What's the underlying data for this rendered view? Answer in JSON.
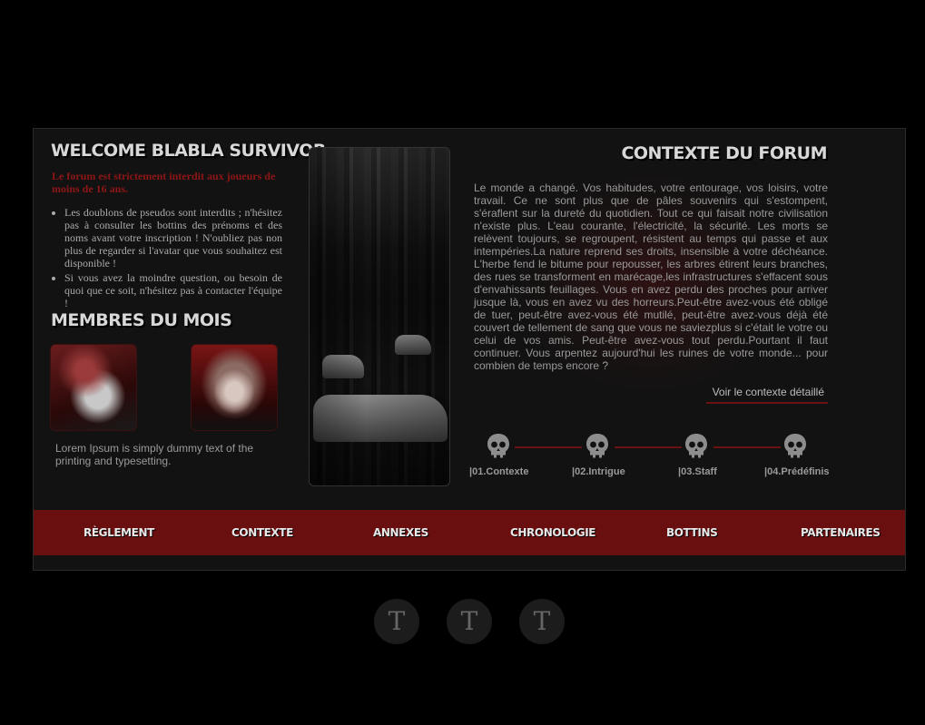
{
  "left": {
    "welcome_title": "WELCOME BLABLA SURVIVOR",
    "warning": "Le forum est strictement interdit aux joueurs de moins de 16 ans.",
    "rules": [
      "Les doublons de pseudos sont interdits ; n'hésitez pas à consulter les bottins des prénoms et des noms avant votre inscription ! N'oubliez pas non plus de regarder si l'avatar que vous souhaitez est disponible !",
      "Si vous avez la moindre question, ou besoin de quoi que ce soit, n'hésitez pas à contacter l'équipe !"
    ],
    "members_title": "MEMBRES DU MOIS",
    "lorem": "Lorem Ipsum is simply dummy text of the printing and typesetting."
  },
  "context": {
    "title": "CONTEXTE DU FORUM",
    "text": "Le monde a changé. Vos habitudes, votre entourage, vos loisirs, votre travail. Ce ne sont plus que de pâles souvenirs qui s'estompent, s'éraflent sur la dureté du quotidien. Tout ce qui faisait notre civilisation n'existe plus. L'eau courante, l'électricité, la sécurité. Les morts se relèvent toujours, se regroupent, résistent au temps qui passe et aux intempéries.La nature reprend ses droits, insensible à votre déchéance. L'herbe fend le bitume pour repousser, les arbres étirent leurs branches, des rues se transforment en marécage,les infrastructures s'effacent sous d'envahissants feuillages. Vous en avez perdu des proches pour arriver jusque là, vous en avez vu des horreurs.Peut-être avez-vous été obligé de tuer, peut-être avez-vous été mutilé, peut-être avez-vous déjà été couvert de tellement de sang que vous ne saviezplus si c'était le votre ou celui de vos amis. Peut-être avez-vous tout perdu.Pourtant il faut continuer. Vous arpentez aujourd'hui les ruines de votre monde... pour combien de temps encore ?",
    "link": "Voir le contexte détaillé"
  },
  "timeline": [
    {
      "label": "|01.Contexte",
      "icon": "skull-icon"
    },
    {
      "label": "|02.Intrigue",
      "icon": "skull-icon"
    },
    {
      "label": "|03.Staff",
      "icon": "skull-icon"
    },
    {
      "label": "|04.Prédéfinis",
      "icon": "skull-icon"
    }
  ],
  "nav": [
    "RÈGLEMENT",
    "CONTEXTE",
    "ANNEXES",
    "CHRONOLOGIE",
    "BOTTINS",
    "PARTENAIRES"
  ],
  "social": [
    "T",
    "T",
    "T"
  ],
  "colors": {
    "accent": "#6a0f0f",
    "background": "#000000",
    "panel": "#121212",
    "warning": "#8e1616"
  }
}
